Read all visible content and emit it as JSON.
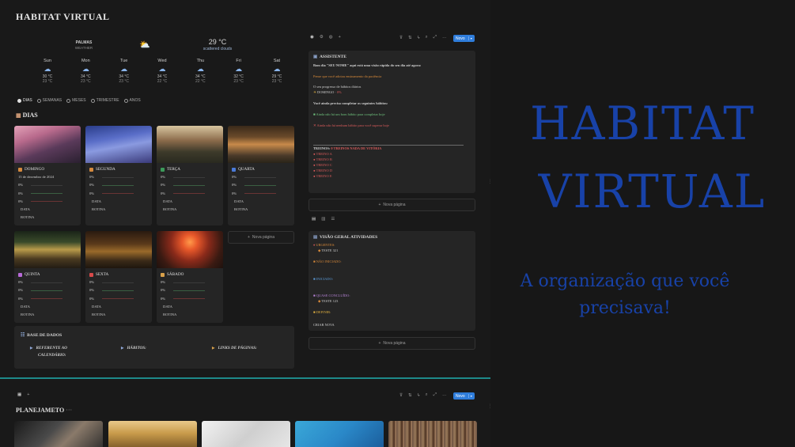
{
  "app": {
    "title": "HABITAT VIRTUAL"
  },
  "weather": {
    "city": "PALMAS",
    "label": "WEATHER",
    "current_temp": "29 °C",
    "current_desc": "scattered clouds",
    "current_icon": "partly-cloudy-icon",
    "days": [
      {
        "name": "Sun",
        "high": "30 °C",
        "low": "23 °C"
      },
      {
        "name": "Mon",
        "high": "34 °C",
        "low": "23 °C"
      },
      {
        "name": "Tue",
        "high": "34 °C",
        "low": "23 °C"
      },
      {
        "name": "Wed",
        "high": "34 °C",
        "low": "22 °C"
      },
      {
        "name": "Thu",
        "high": "34 °C",
        "low": "22 °C"
      },
      {
        "name": "Fri",
        "high": "32 °C",
        "low": "23 °C"
      },
      {
        "name": "Sat",
        "high": "29 °C",
        "low": "23 °C"
      }
    ]
  },
  "view_tabs": [
    "DIAS",
    "SEMANAS",
    "MESES",
    "TRIMESTRE",
    "ANOS"
  ],
  "dias": {
    "title": "DIAS",
    "row1": [
      {
        "name": "DOMINGO",
        "date": "15 de dezembro de 2024",
        "pcts": [
          "0%",
          "0%",
          "0%"
        ],
        "labels": [
          "DATA",
          "ROTINA"
        ]
      },
      {
        "name": "SEGUNDA",
        "pcts": [
          "0%",
          "0%",
          "0%"
        ],
        "labels": [
          "DATA",
          "ROTINA"
        ]
      },
      {
        "name": "TERÇA",
        "pcts": [
          "0%",
          "0%",
          "0%"
        ],
        "labels": [
          "DATA",
          "ROTINA"
        ]
      },
      {
        "name": "QUARTA",
        "pcts": [
          "0%",
          "0%",
          "0%"
        ],
        "labels": [
          "DATA",
          "ROTINA"
        ]
      }
    ],
    "row2": [
      {
        "name": "QUINTA",
        "pcts": [
          "0%",
          "0%",
          "0%"
        ],
        "labels": [
          "DATA",
          "ROTINA"
        ]
      },
      {
        "name": "SEXTA",
        "pcts": [
          "0%",
          "0%",
          "0%"
        ],
        "labels": [
          "DATA",
          "ROTINA"
        ]
      },
      {
        "name": "SÁBADO",
        "pcts": [
          "0%",
          "0%",
          "0%"
        ],
        "labels": [
          "DATA",
          "ROTINA"
        ]
      }
    ],
    "new_page": "Nova página"
  },
  "database": {
    "title": "BASE DE DADOS",
    "links": [
      "REFERENTE AO",
      "CALENDÁRIO:",
      "HÁBITOS:",
      "LINKS DE PÁGINAS:"
    ]
  },
  "toolbar": {
    "new_label": "Novo"
  },
  "assistant": {
    "title": "ASSISTENTE",
    "greeting": "Bom dia \"SEU NOME\" aqui está uma visão rápida do seu dia até agora:",
    "motivation": "Pense que você adotou ensinamento da paciência",
    "progress_label": "O seu progresso de hábitos diários",
    "progress_day": "DOMINGO",
    "progress_value": "0%",
    "need_label": "Você ainda precisa completar os seguintes hábitos:",
    "good_msg": "Ainda não há um bom hábito para completar hoje",
    "bad_msg": "Ainda não há nenhum hábito para você superar hoje",
    "treinos_label": "TREINOS:",
    "treinos_value": "0 TREINOS NADA DE VITÓRIA",
    "treinos": [
      "TREINO A",
      "TREINO B",
      "TREINO C",
      "TREINO D",
      "TREINO E"
    ]
  },
  "overview": {
    "title": "VISÃO GERAL ATIVIDADES",
    "urgentes": "URGENTES:",
    "teste1": "TESTE 321",
    "nao_iniciado": "NÃO INICIADO:",
    "iniciado": "INICIADO:",
    "quase": "QUASE CONCLUÍDO:",
    "teste2": "TESTE 123",
    "definir": "DEFINIR:",
    "criar": "CRIAR NOVA"
  },
  "planejamento": {
    "title": "PLANEJAMETO",
    "more": "···"
  },
  "promo": {
    "line1": "HABITAT",
    "line2": "VIRTUAL",
    "sub1": "A organização que você",
    "sub2": "precisava!"
  },
  "colors": {
    "accent": "#2f7ddb",
    "promo_blue": "#1842a8",
    "teal": "#1d8a8a"
  }
}
